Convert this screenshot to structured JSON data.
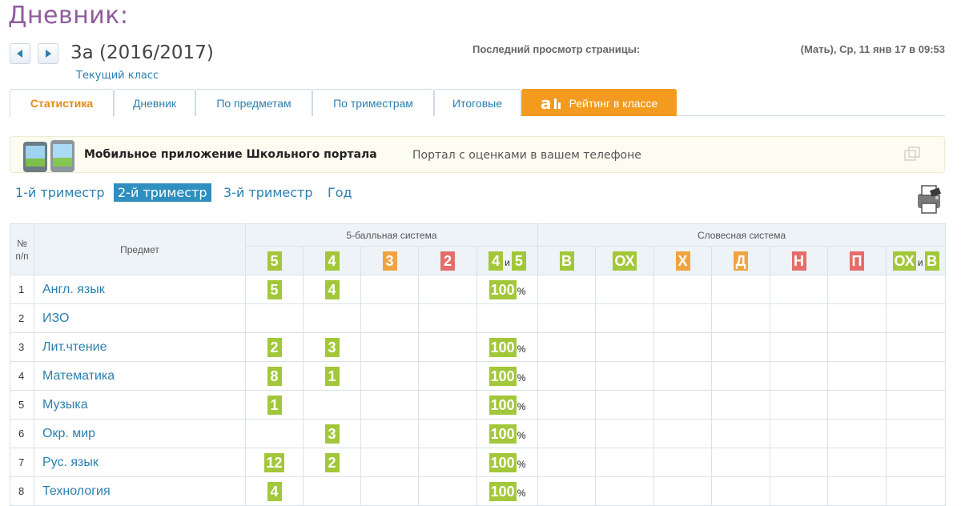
{
  "page_title": "Дневник:",
  "class_name": "3а (2016/2017)",
  "class_subtitle": "Текущий класс",
  "last_view": {
    "label": "Последний просмотр страницы:",
    "value": "(Мать), Ср, 11 янв 17 в 09:53"
  },
  "tabs": [
    {
      "label": "Статистика",
      "active": true
    },
    {
      "label": "Дневник"
    },
    {
      "label": "По предметам"
    },
    {
      "label": "По триместрам"
    },
    {
      "label": "Итоговые"
    },
    {
      "label": "Рейтинг в классе",
      "logo_text": "a"
    }
  ],
  "banner": {
    "title": "Мобильное приложение Школьного портала",
    "subtitle": "Портал с оценками в вашем телефоне"
  },
  "periods": [
    "1-й триместр",
    "2-й триместр",
    "3-й триместр",
    "Год"
  ],
  "active_period": "2-й триместр",
  "table": {
    "num_header": "№ п/п",
    "subject_header": "Предмет",
    "group_five": "5-балльная система",
    "group_verbal": "Словесная система",
    "and_word": "и",
    "five_cols": [
      "5",
      "4",
      "3",
      "2"
    ],
    "five_combo": [
      "4",
      "5"
    ],
    "verbal_cols": [
      "В",
      "ОХ",
      "Х",
      "Д",
      "Н",
      "П"
    ],
    "verbal_combo": [
      "ОХ",
      "В"
    ],
    "percent_sign": "%",
    "rows": [
      {
        "num": "1",
        "subject": "Англ. язык",
        "g5": "5",
        "g4": "4",
        "g3": "",
        "g2": "",
        "pct": "100"
      },
      {
        "num": "2",
        "subject": "ИЗО",
        "g5": "",
        "g4": "",
        "g3": "",
        "g2": "",
        "pct": ""
      },
      {
        "num": "3",
        "subject": "Лит.чтение",
        "g5": "2",
        "g4": "3",
        "g3": "",
        "g2": "",
        "pct": "100"
      },
      {
        "num": "4",
        "subject": "Математика",
        "g5": "8",
        "g4": "1",
        "g3": "",
        "g2": "",
        "pct": "100"
      },
      {
        "num": "5",
        "subject": "Музыка",
        "g5": "1",
        "g4": "",
        "g3": "",
        "g2": "",
        "pct": "100"
      },
      {
        "num": "6",
        "subject": "Окр. мир",
        "g5": "",
        "g4": "3",
        "g3": "",
        "g2": "",
        "pct": "100"
      },
      {
        "num": "7",
        "subject": "Рус. язык",
        "g5": "12",
        "g4": "2",
        "g3": "",
        "g2": "",
        "pct": "100"
      },
      {
        "num": "8",
        "subject": "Технология",
        "g5": "4",
        "g4": "",
        "g3": "",
        "g2": "",
        "pct": "100"
      }
    ]
  },
  "colors": {
    "title": "#8e5c9c",
    "link": "#2b7fae",
    "grade_green": "#a3c73a",
    "grade_orange": "#f0a340",
    "grade_red": "#e56d6a",
    "rating_tab": "#f39b1f"
  }
}
